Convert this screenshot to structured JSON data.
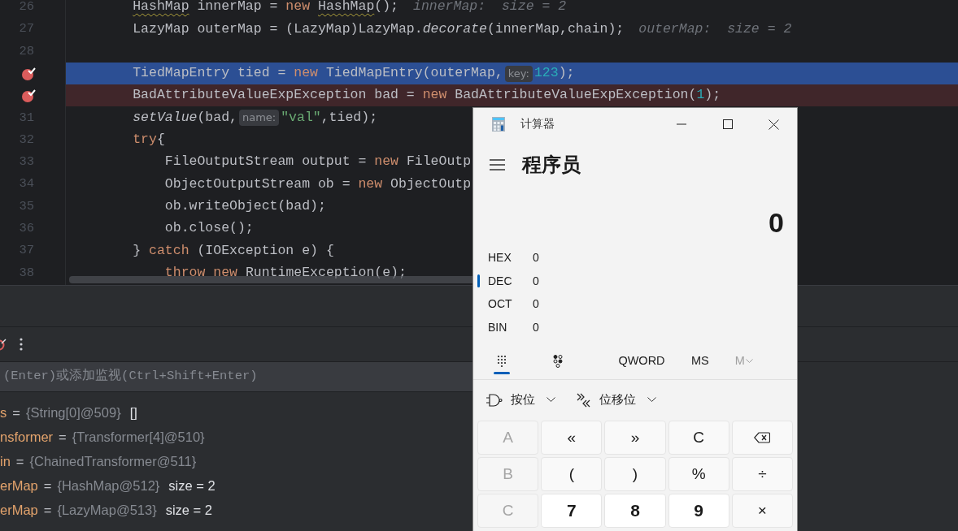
{
  "editor": {
    "lines": [
      {
        "number": "26",
        "breakpoint": false,
        "execution_point": false,
        "tokens": [
          {
            "kind": "warn",
            "text": "        HashMap"
          },
          {
            "kind": "text",
            "text": " innerMap = "
          },
          {
            "kind": "keyword",
            "text": "new"
          },
          {
            "kind": "warn",
            "text": " HashMap"
          },
          {
            "kind": "text",
            "text": "();"
          },
          {
            "kind": "hint",
            "text": "innerMap:  size = 2"
          }
        ]
      },
      {
        "number": "27",
        "breakpoint": false,
        "execution_point": false,
        "tokens": [
          {
            "kind": "text",
            "text": "        LazyMap outerMap = (LazyMap)LazyMap."
          },
          {
            "kind": "italic",
            "text": "decorate"
          },
          {
            "kind": "text",
            "text": "(innerMap,chain);"
          },
          {
            "kind": "hint",
            "text": "outerMap:  size = 2"
          }
        ]
      },
      {
        "number": "28",
        "breakpoint": false,
        "execution_point": false
      },
      {
        "breakpoint": true,
        "execution_point": true,
        "tokens": [
          {
            "kind": "text",
            "text": "        TiedMapEntry tied = "
          },
          {
            "kind": "keyword",
            "text": "new"
          },
          {
            "kind": "text",
            "text": " TiedMapEntry(outerMap,"
          },
          {
            "kind": "inlay",
            "text": "key:"
          },
          {
            "kind": "number",
            "text": "123"
          },
          {
            "kind": "text",
            "text": ");"
          }
        ]
      },
      {
        "breakpoint": true,
        "execution_point": false,
        "tokens": [
          {
            "kind": "text",
            "text": "        BadAttributeValueExpException bad = "
          },
          {
            "kind": "keyword",
            "text": "new"
          },
          {
            "kind": "text",
            "text": " BadAttributeValueExpException("
          },
          {
            "kind": "number",
            "text": "1"
          },
          {
            "kind": "text",
            "text": ");"
          }
        ]
      },
      {
        "number": "31",
        "breakpoint": false,
        "execution_point": false,
        "tokens": [
          {
            "kind": "italic",
            "text": "        setValue"
          },
          {
            "kind": "text",
            "text": "(bad,"
          },
          {
            "kind": "inlay",
            "text": "name:"
          },
          {
            "kind": "string",
            "text": "\"val\""
          },
          {
            "kind": "text",
            "text": ",tied);"
          }
        ]
      },
      {
        "number": "32",
        "breakpoint": false,
        "execution_point": false,
        "tokens": [
          {
            "kind": "keyword",
            "text": "        try"
          },
          {
            "kind": "text",
            "text": "{"
          }
        ]
      },
      {
        "number": "33",
        "breakpoint": false,
        "execution_point": false,
        "tokens": [
          {
            "kind": "text",
            "text": "            FileOutputStream output = "
          },
          {
            "kind": "keyword",
            "text": "new"
          },
          {
            "kind": "text",
            "text": " FileOutp"
          }
        ]
      },
      {
        "number": "34",
        "breakpoint": false,
        "execution_point": false,
        "tokens": [
          {
            "kind": "text",
            "text": "            ObjectOutputStream ob = "
          },
          {
            "kind": "keyword",
            "text": "new"
          },
          {
            "kind": "text",
            "text": " ObjectOutp"
          }
        ]
      },
      {
        "number": "35",
        "breakpoint": false,
        "execution_point": false,
        "tokens": [
          {
            "kind": "text",
            "text": "            ob.writeObject(bad);"
          }
        ]
      },
      {
        "number": "36",
        "breakpoint": false,
        "execution_point": false,
        "tokens": [
          {
            "kind": "text",
            "text": "            ob.close();"
          }
        ]
      },
      {
        "number": "37",
        "breakpoint": false,
        "execution_point": false,
        "tokens": [
          {
            "kind": "text",
            "text": "        } "
          },
          {
            "kind": "keyword",
            "text": "catch"
          },
          {
            "kind": "text",
            "text": " (IOException e) {"
          }
        ]
      },
      {
        "number": "38",
        "breakpoint": false,
        "execution_point": false,
        "tokens": [
          {
            "kind": "keyword",
            "text": "            throw"
          },
          {
            "kind": "keyword",
            "text": " new"
          },
          {
            "kind": "text",
            "text": " RuntimeException(e);"
          }
        ]
      }
    ]
  },
  "debugger": {
    "eval_placeholder": "(Enter)或添加监视(Ctrl+Shift+Enter)",
    "variables": [
      {
        "name": "s",
        "separator": "=",
        "value": "{String[0]@509}",
        "extra": "[]"
      },
      {
        "name": "nsformer",
        "separator": "=",
        "value": "{Transformer[4]@510}"
      },
      {
        "name": "in",
        "separator": "=",
        "value": "{ChainedTransformer@511}"
      },
      {
        "name": "erMap",
        "separator": "=",
        "value": "{HashMap@512}",
        "extra": "size = 2"
      },
      {
        "name": "erMap",
        "separator": "=",
        "value": "{LazyMap@513}",
        "extra": "size = 2"
      }
    ]
  },
  "calculator": {
    "title": "计算器",
    "mode": "程序员",
    "display": "0",
    "radixes": [
      {
        "label": "HEX",
        "value": "0",
        "selected": false
      },
      {
        "label": "DEC",
        "value": "0",
        "selected": true
      },
      {
        "label": "OCT",
        "value": "0",
        "selected": false
      },
      {
        "label": "BIN",
        "value": "0",
        "selected": false
      }
    ],
    "pads": [
      {
        "kind": "keypad",
        "selected": true
      },
      {
        "kind": "bits",
        "selected": false
      }
    ],
    "word_size": "QWORD",
    "memory": [
      {
        "label": "MS",
        "disabled": false,
        "dropdown": false
      },
      {
        "label": "M",
        "disabled": true,
        "dropdown": true
      }
    ],
    "dropdowns": [
      {
        "kind": "bitwise",
        "label": "按位"
      },
      {
        "kind": "shift",
        "label": "位移位"
      }
    ],
    "keys": [
      {
        "kind": "letter",
        "label": "A",
        "disabled": true
      },
      {
        "kind": "operator",
        "label": "«",
        "disabled": false
      },
      {
        "kind": "operator",
        "label": "»",
        "disabled": false
      },
      {
        "kind": "operator",
        "label": "C",
        "disabled": false
      },
      {
        "kind": "backspace",
        "disabled": false
      },
      {
        "kind": "letter",
        "label": "B",
        "disabled": true
      },
      {
        "kind": "operator",
        "label": "(",
        "disabled": false
      },
      {
        "kind": "operator",
        "label": ")",
        "disabled": false
      },
      {
        "kind": "operator",
        "label": "%",
        "disabled": false
      },
      {
        "kind": "operator",
        "label": "÷",
        "disabled": false
      },
      {
        "kind": "letter",
        "label": "C",
        "disabled": true
      },
      {
        "kind": "digit",
        "label": "7",
        "disabled": false
      },
      {
        "kind": "digit",
        "label": "8",
        "disabled": false
      },
      {
        "kind": "digit",
        "label": "9",
        "disabled": false
      },
      {
        "kind": "operator",
        "label": "×",
        "disabled": false
      }
    ]
  }
}
